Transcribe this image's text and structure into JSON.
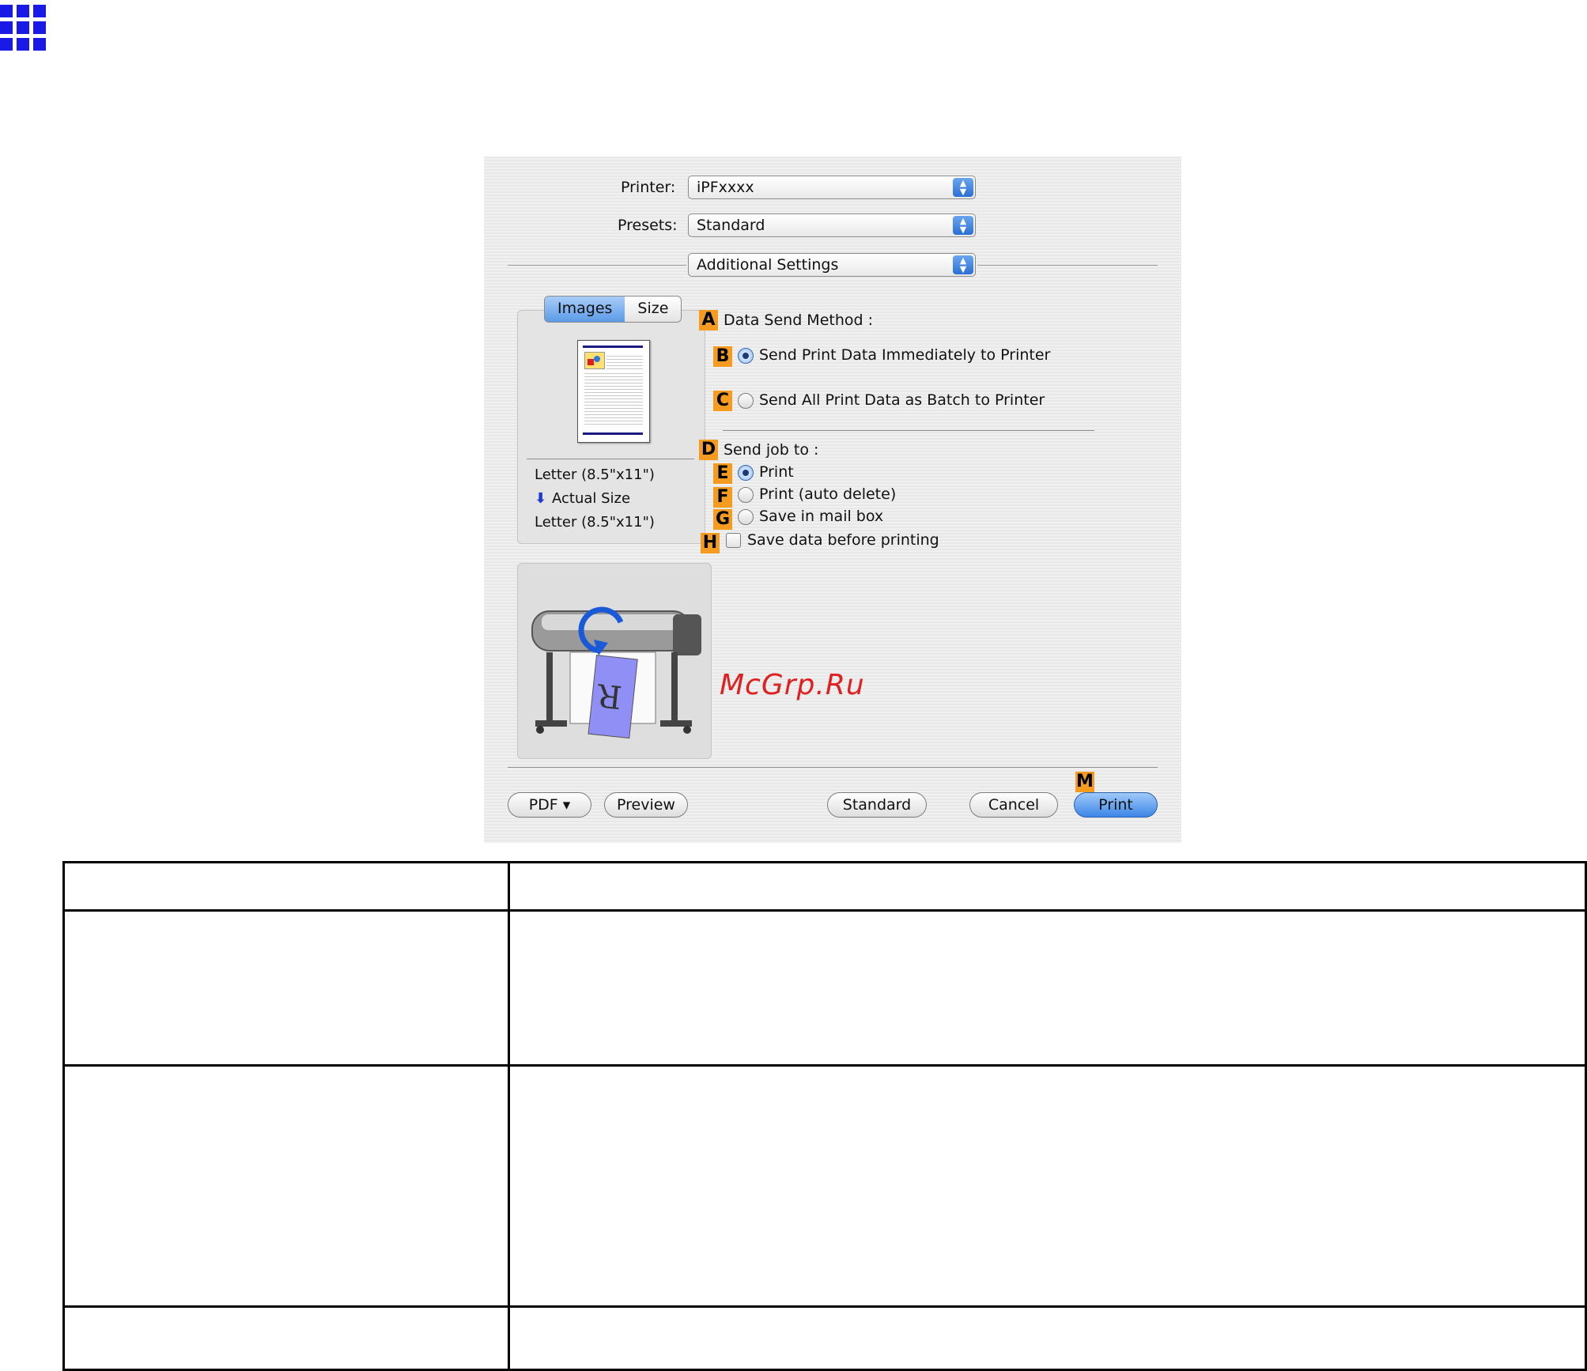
{
  "dialog": {
    "printer_label": "Printer:",
    "printer_value": "iPFxxxx",
    "presets_label": "Presets:",
    "presets_value": "Standard",
    "panel_value": "Additional Settings",
    "tabs": [
      {
        "label": "Images"
      },
      {
        "label": "Size"
      }
    ],
    "preview": {
      "paper1": "Letter (8.5\"x11\")",
      "scale": "Actual Size",
      "paper2": "Letter (8.5\"x11\")"
    },
    "data_send_method_label": "Data Send Method :",
    "option_send_immediately": "Send Print Data Immediately to Printer",
    "option_send_batch": "Send All Print Data as Batch to Printer",
    "send_job_to_label": "Send job to :",
    "option_print": "Print",
    "option_print_auto_delete": "Print (auto delete)",
    "option_save_mail_box": "Save in mail box",
    "option_save_before_printing": "Save data before printing",
    "badges": {
      "A": "A",
      "B": "B",
      "C": "C",
      "D": "D",
      "E": "E",
      "F": "F",
      "G": "G",
      "H": "H",
      "M": "M"
    },
    "printer_image_letter": "R",
    "watermark": "McGrp.Ru",
    "buttons": {
      "pdf": "PDF ▾",
      "preview": "Preview",
      "standard": "Standard",
      "cancel": "Cancel",
      "print": "Print"
    }
  },
  "colors": {
    "accent": "#1a1ae6",
    "badge": "#f59b20",
    "watermark": "#e02020"
  }
}
